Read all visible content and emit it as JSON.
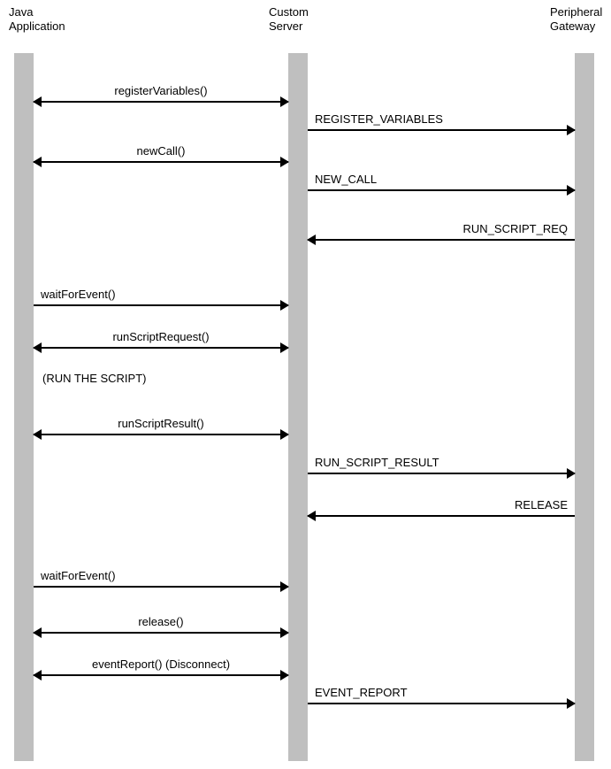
{
  "actors": {
    "java": "Java\nApplication",
    "custom": "Custom\nServer",
    "peripheral": "Peripheral\nGateway"
  },
  "messages": {
    "m1": "registerVariables()",
    "m2": "REGISTER_VARIABLES",
    "m3": "newCall()",
    "m4": "NEW_CALL",
    "m5": "RUN_SCRIPT_REQ",
    "m6": "waitForEvent()",
    "m7": "runScriptRequest()",
    "m8": "runScriptResult()",
    "m9": "RUN_SCRIPT_RESULT",
    "m10": "RELEASE",
    "m11": "waitForEvent()",
    "m12": "release()",
    "m13": "eventReport() (Disconnect)",
    "m14": "EVENT_REPORT"
  },
  "note": "(RUN THE SCRIPT)"
}
